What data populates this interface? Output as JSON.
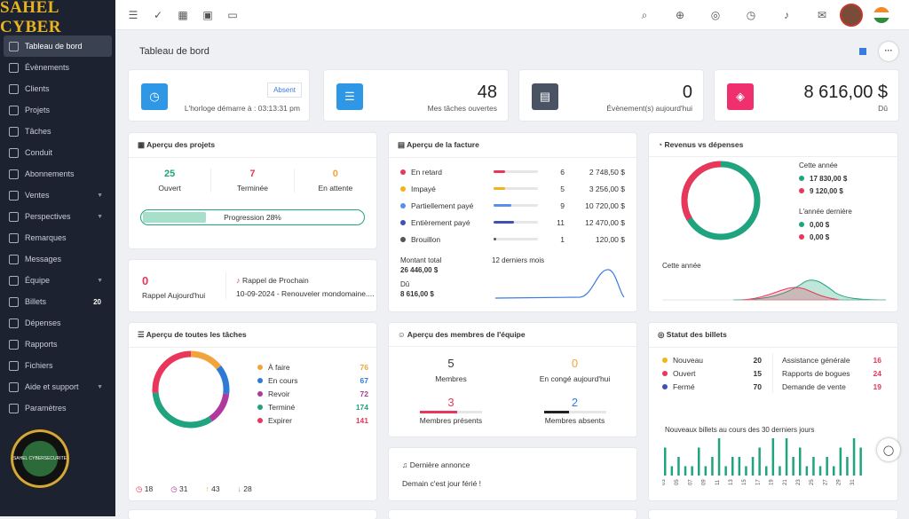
{
  "brand": {
    "logo": "SAHEL CYBER",
    "emblem_text": "SAHEL CYBERSECURITE"
  },
  "sidebar": {
    "items": [
      {
        "label": "Tableau de bord",
        "active": true
      },
      {
        "label": "Évènements"
      },
      {
        "label": "Clients"
      },
      {
        "label": "Projets"
      },
      {
        "label": "Tâches"
      },
      {
        "label": "Conduit"
      },
      {
        "label": "Abonnements"
      },
      {
        "label": "Ventes",
        "chevron": true
      },
      {
        "label": "Perspectives",
        "chevron": true
      },
      {
        "label": "Remarques"
      },
      {
        "label": "Messages"
      },
      {
        "label": "Équipe",
        "chevron": true
      },
      {
        "label": "Billets",
        "badge": "20"
      },
      {
        "label": "Dépenses"
      },
      {
        "label": "Rapports"
      },
      {
        "label": "Fichiers"
      },
      {
        "label": "Aide et support",
        "chevron": true
      },
      {
        "label": "Paramètres"
      }
    ]
  },
  "page": {
    "title": "Tableau de bord"
  },
  "stats": {
    "clock": {
      "button": "Absent",
      "text": "L'horloge démarre à : 03:13:31 pm"
    },
    "tasks": {
      "value": "48",
      "label": "Mes tâches ouvertes"
    },
    "events": {
      "value": "0",
      "label": "Évènement(s) aujourd'hui"
    },
    "due": {
      "value": "8 616,00 $",
      "label": "Dû"
    }
  },
  "projects": {
    "title": "Aperçu des projets",
    "open": "25",
    "open_label": "Ouvert",
    "done": "7",
    "done_label": "Terminée",
    "pending": "0",
    "pending_label": "En attente",
    "progress_label": "Progression 28%",
    "progress": 0.28
  },
  "reminder": {
    "count": "0",
    "label": "Rappel Aujourd'hui",
    "next_title": "Rappel de Prochain",
    "next_text": "10-09-2024 - Renouveler mondomaine...."
  },
  "invoice": {
    "title": "Aperçu de la facture",
    "rows": [
      {
        "label": "En retard",
        "count": "6",
        "amount": "2 748,50 $",
        "color": "#e8375a",
        "fill": 0.25
      },
      {
        "label": "Impayé",
        "count": "5",
        "amount": "3 256,00 $",
        "color": "#f1b51c",
        "fill": 0.25
      },
      {
        "label": "Partiellement payé",
        "count": "9",
        "amount": "10 720,00 $",
        "color": "#5b8def",
        "fill": 0.4
      },
      {
        "label": "Entièrement payé",
        "count": "11",
        "amount": "12 470,00 $",
        "color": "#3f51b5",
        "fill": 0.45
      },
      {
        "label": "Brouillon",
        "count": "1",
        "amount": "120,00 $",
        "color": "#555",
        "fill": 0.05
      }
    ],
    "total_label": "Montant total",
    "total": "26 446,00 $",
    "due_label": "Dû",
    "due": "8 616,00 $",
    "period": "12 derniers mois"
  },
  "revenue": {
    "title": "Revenus vs dépenses",
    "this_year": "Cette année",
    "v1": "17 830,00 $",
    "v2": "9 120,00 $",
    "last_year": "L'année dernière",
    "v3": "0,00 $",
    "v4": "0,00 $",
    "chart_label": "Cette année"
  },
  "alltasks": {
    "title": "Aperçu de toutes les tâches",
    "items": [
      {
        "label": "À faire",
        "value": "76",
        "color": "#f1a43c"
      },
      {
        "label": "En cours",
        "value": "67",
        "color": "#2e7bd6"
      },
      {
        "label": "Revoir",
        "value": "72",
        "color": "#b1399e"
      },
      {
        "label": "Terminé",
        "value": "174",
        "color": "#20a37f"
      },
      {
        "label": "Expirer",
        "value": "141",
        "color": "#e8375a"
      }
    ],
    "footer": [
      {
        "value": "18",
        "color": "#e8375a"
      },
      {
        "value": "31",
        "color": "#b1399e"
      },
      {
        "value": "43",
        "color": "#f1a43c"
      },
      {
        "value": "28",
        "color": "#888"
      }
    ]
  },
  "team": {
    "title": "Aperçu des membres de l'équipe",
    "members": "5",
    "members_label": "Membres",
    "leave": "0",
    "leave_label": "En congé aujourd'hui",
    "present": "3",
    "present_label": "Membres présents",
    "absent": "2",
    "absent_label": "Membres absents"
  },
  "announce": {
    "title": "Dernière annonce",
    "text": "Demain c'est jour férié !"
  },
  "tickets": {
    "title": "Statut des billets",
    "left": [
      {
        "label": "Nouveau",
        "value": "20",
        "color": "#f1b51c"
      },
      {
        "label": "Ouvert",
        "value": "15",
        "color": "#e8375a"
      },
      {
        "label": "Fermé",
        "value": "70",
        "color": "#3f51b5"
      }
    ],
    "right": [
      {
        "label": "Assistance générale",
        "value": "16"
      },
      {
        "label": "Rapports de bogues",
        "value": "24"
      },
      {
        "label": "Demande de vente",
        "value": "19"
      }
    ],
    "chart_title": "Nouveaux billets au cours des 30 derniers jours",
    "ticks": [
      "03",
      "05",
      "07",
      "09",
      "11",
      "13",
      "15",
      "17",
      "19",
      "21",
      "23",
      "25",
      "27",
      "29",
      "31"
    ],
    "bars": [
      3,
      1,
      2,
      1,
      1,
      3,
      1,
      2,
      4,
      1,
      2,
      2,
      1,
      2,
      3,
      1,
      4,
      1,
      4,
      2,
      3,
      1,
      2,
      1,
      2,
      1,
      3,
      2,
      4,
      3
    ]
  }
}
